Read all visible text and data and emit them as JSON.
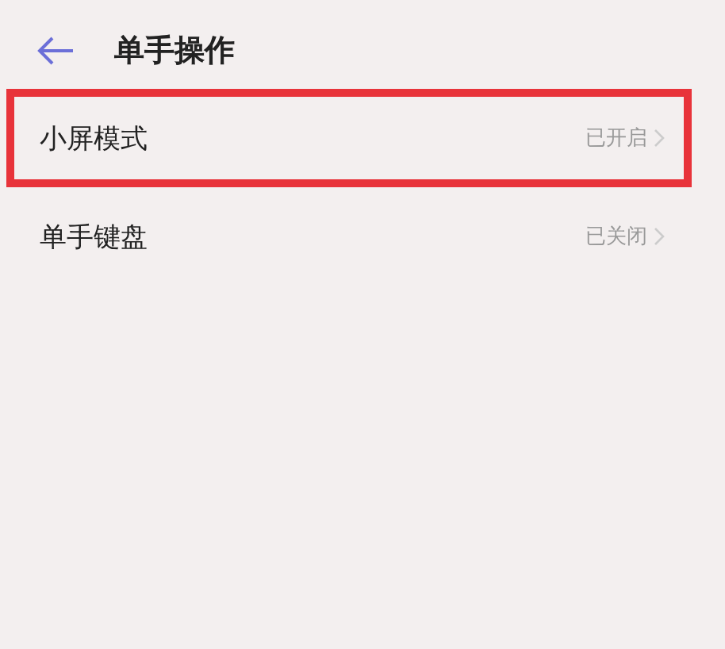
{
  "header": {
    "title": "单手操作"
  },
  "items": [
    {
      "label": "小屏模式",
      "value": "已开启",
      "highlighted": true
    },
    {
      "label": "单手键盘",
      "value": "已关闭",
      "highlighted": false
    }
  ]
}
